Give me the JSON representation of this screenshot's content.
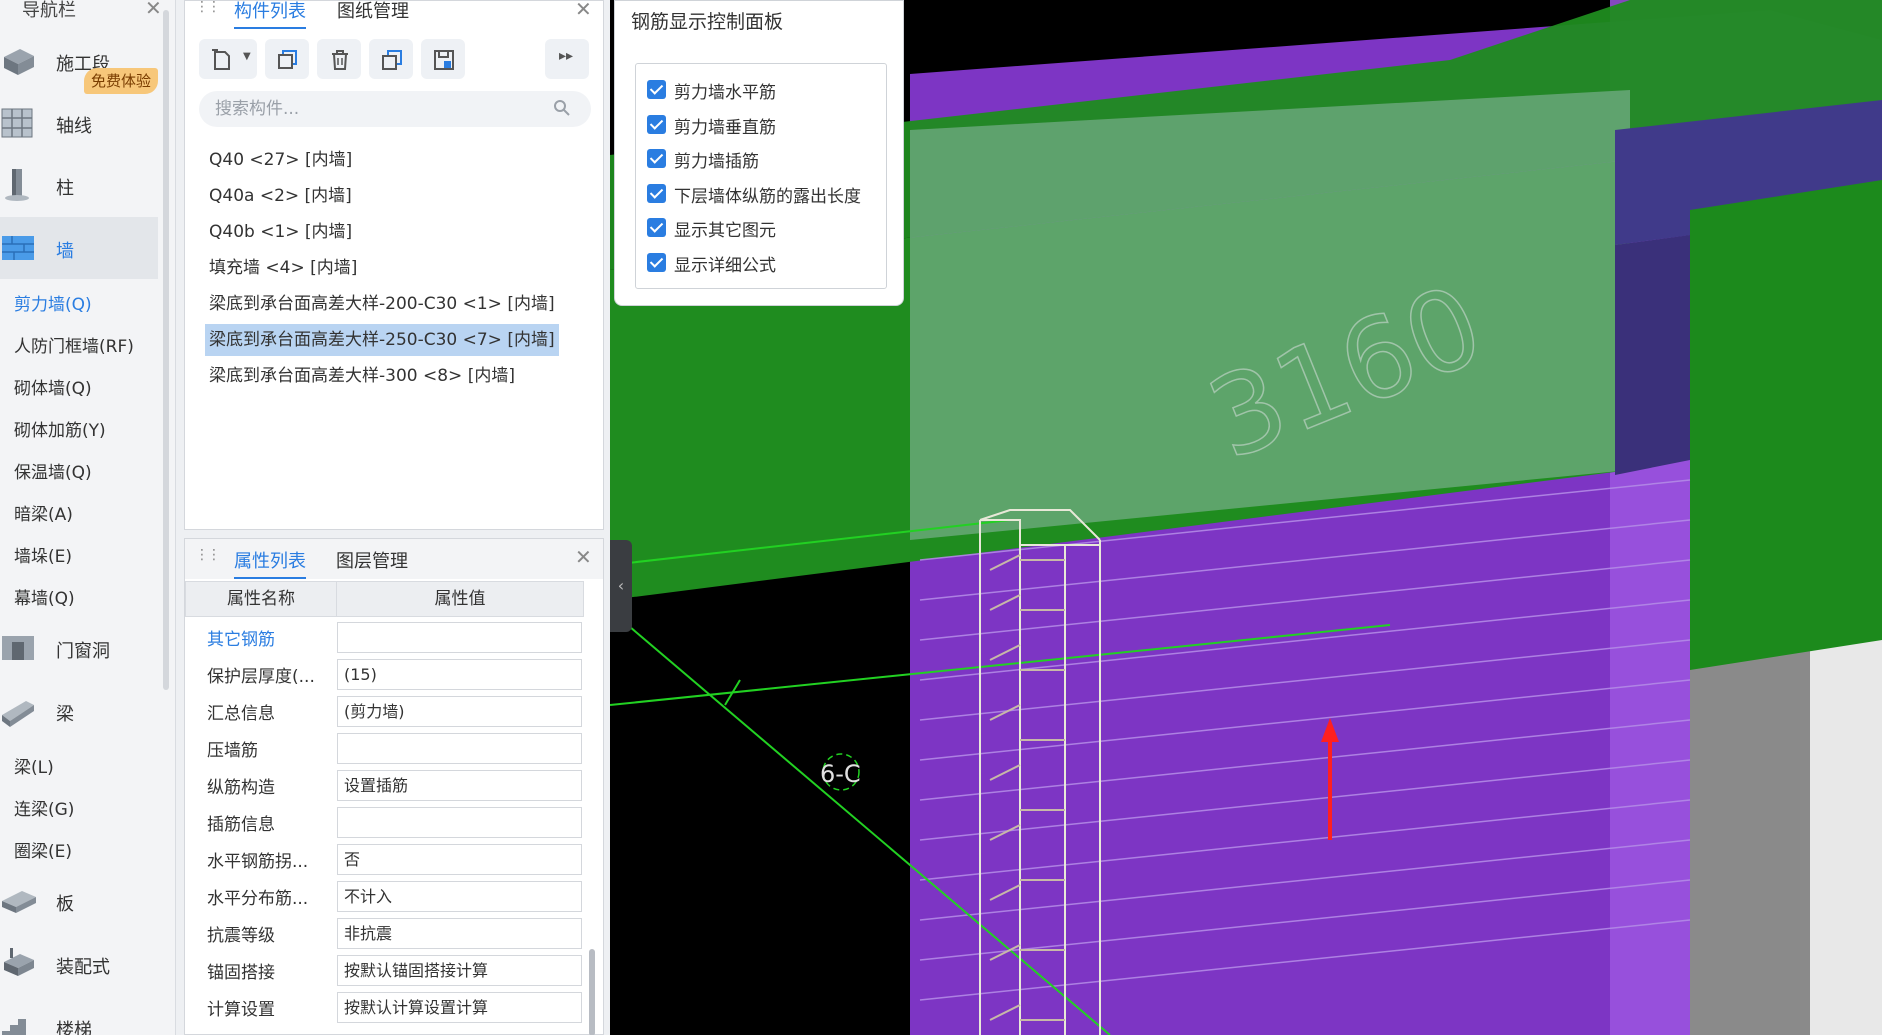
{
  "nav": {
    "title": "导航栏",
    "badge": "免费体验",
    "categories": [
      {
        "label": "施工段",
        "icon": "construction-stage-icon"
      },
      {
        "label": "轴线",
        "icon": "axis-grid-icon"
      },
      {
        "label": "柱",
        "icon": "column-icon"
      },
      {
        "label": "墙",
        "icon": "wall-icon"
      },
      {
        "label": "门窗洞",
        "icon": "door-window-icon"
      },
      {
        "label": "梁",
        "icon": "beam-icon"
      },
      {
        "label": "板",
        "icon": "slab-icon"
      },
      {
        "label": "装配式",
        "icon": "prefab-icon"
      },
      {
        "label": "楼梯",
        "icon": "stair-icon"
      }
    ],
    "wall_items": [
      "剪力墙(Q)",
      "人防门框墙(RF)",
      "砌体墙(Q)",
      "砌体加筋(Y)",
      "保温墙(Q)",
      "暗梁(A)",
      "墙垛(E)",
      "幕墙(Q)"
    ],
    "beam_items": [
      "梁(L)",
      "连梁(G)",
      "圈梁(E)"
    ]
  },
  "component_panel": {
    "tabs": [
      "构件列表",
      "图纸管理"
    ],
    "search_placeholder": "搜索构件...",
    "toolbar_icons": [
      "new-component-icon",
      "dropdown-caret-icon",
      "copy-icon",
      "delete-icon",
      "layer-copy-icon",
      "save-template-icon",
      "more-icon"
    ],
    "items": [
      "Q40 <27> [内墙]",
      "Q40a <2> [内墙]",
      "Q40b <1> [内墙]",
      "填充墙 <4> [内墙]",
      "梁底到承台面高差大样-200-C30 <1> [内墙]",
      "梁底到承台面高差大样-250-C30 <7> [内墙]",
      "梁底到承台面高差大样-300 <8> [内墙]"
    ],
    "selected_index": 5
  },
  "property_panel": {
    "tabs": [
      "属性列表",
      "图层管理"
    ],
    "headers": [
      "属性名称",
      "属性值"
    ],
    "rows": [
      {
        "name": "其它钢筋",
        "value": ""
      },
      {
        "name": "保护层厚度(...",
        "value": "(15)"
      },
      {
        "name": "汇总信息",
        "value": "(剪力墙)"
      },
      {
        "name": "压墙筋",
        "value": ""
      },
      {
        "name": "纵筋构造",
        "value": "设置插筋"
      },
      {
        "name": "插筋信息",
        "value": ""
      },
      {
        "name": "水平钢筋拐...",
        "value": "否"
      },
      {
        "name": "水平分布筋...",
        "value": "不计入"
      },
      {
        "name": "抗震等级",
        "value": "非抗震"
      },
      {
        "name": "锚固搭接",
        "value": "按默认锚固搭接计算"
      },
      {
        "name": "计算设置",
        "value": "按默认计算设置计算"
      }
    ]
  },
  "rebar_panel": {
    "title": "钢筋显示控制面板",
    "options": [
      {
        "label": "剪力墙水平筋",
        "checked": true
      },
      {
        "label": "剪力墙垂直筋",
        "checked": true
      },
      {
        "label": "剪力墙插筋",
        "checked": true
      },
      {
        "label": "下层墙体纵筋的露出长度",
        "checked": true
      },
      {
        "label": "显示其它图元",
        "checked": true
      },
      {
        "label": "显示详细公式",
        "checked": true
      }
    ]
  },
  "viewport": {
    "axis_label": "6-C",
    "dimension_text": "3160",
    "colors": {
      "wall_purple": "#7d35c4",
      "slab_green": "#1f8c1f",
      "axis_line": "#22d122",
      "arrow": "#ff2020",
      "background": "#000000"
    }
  }
}
